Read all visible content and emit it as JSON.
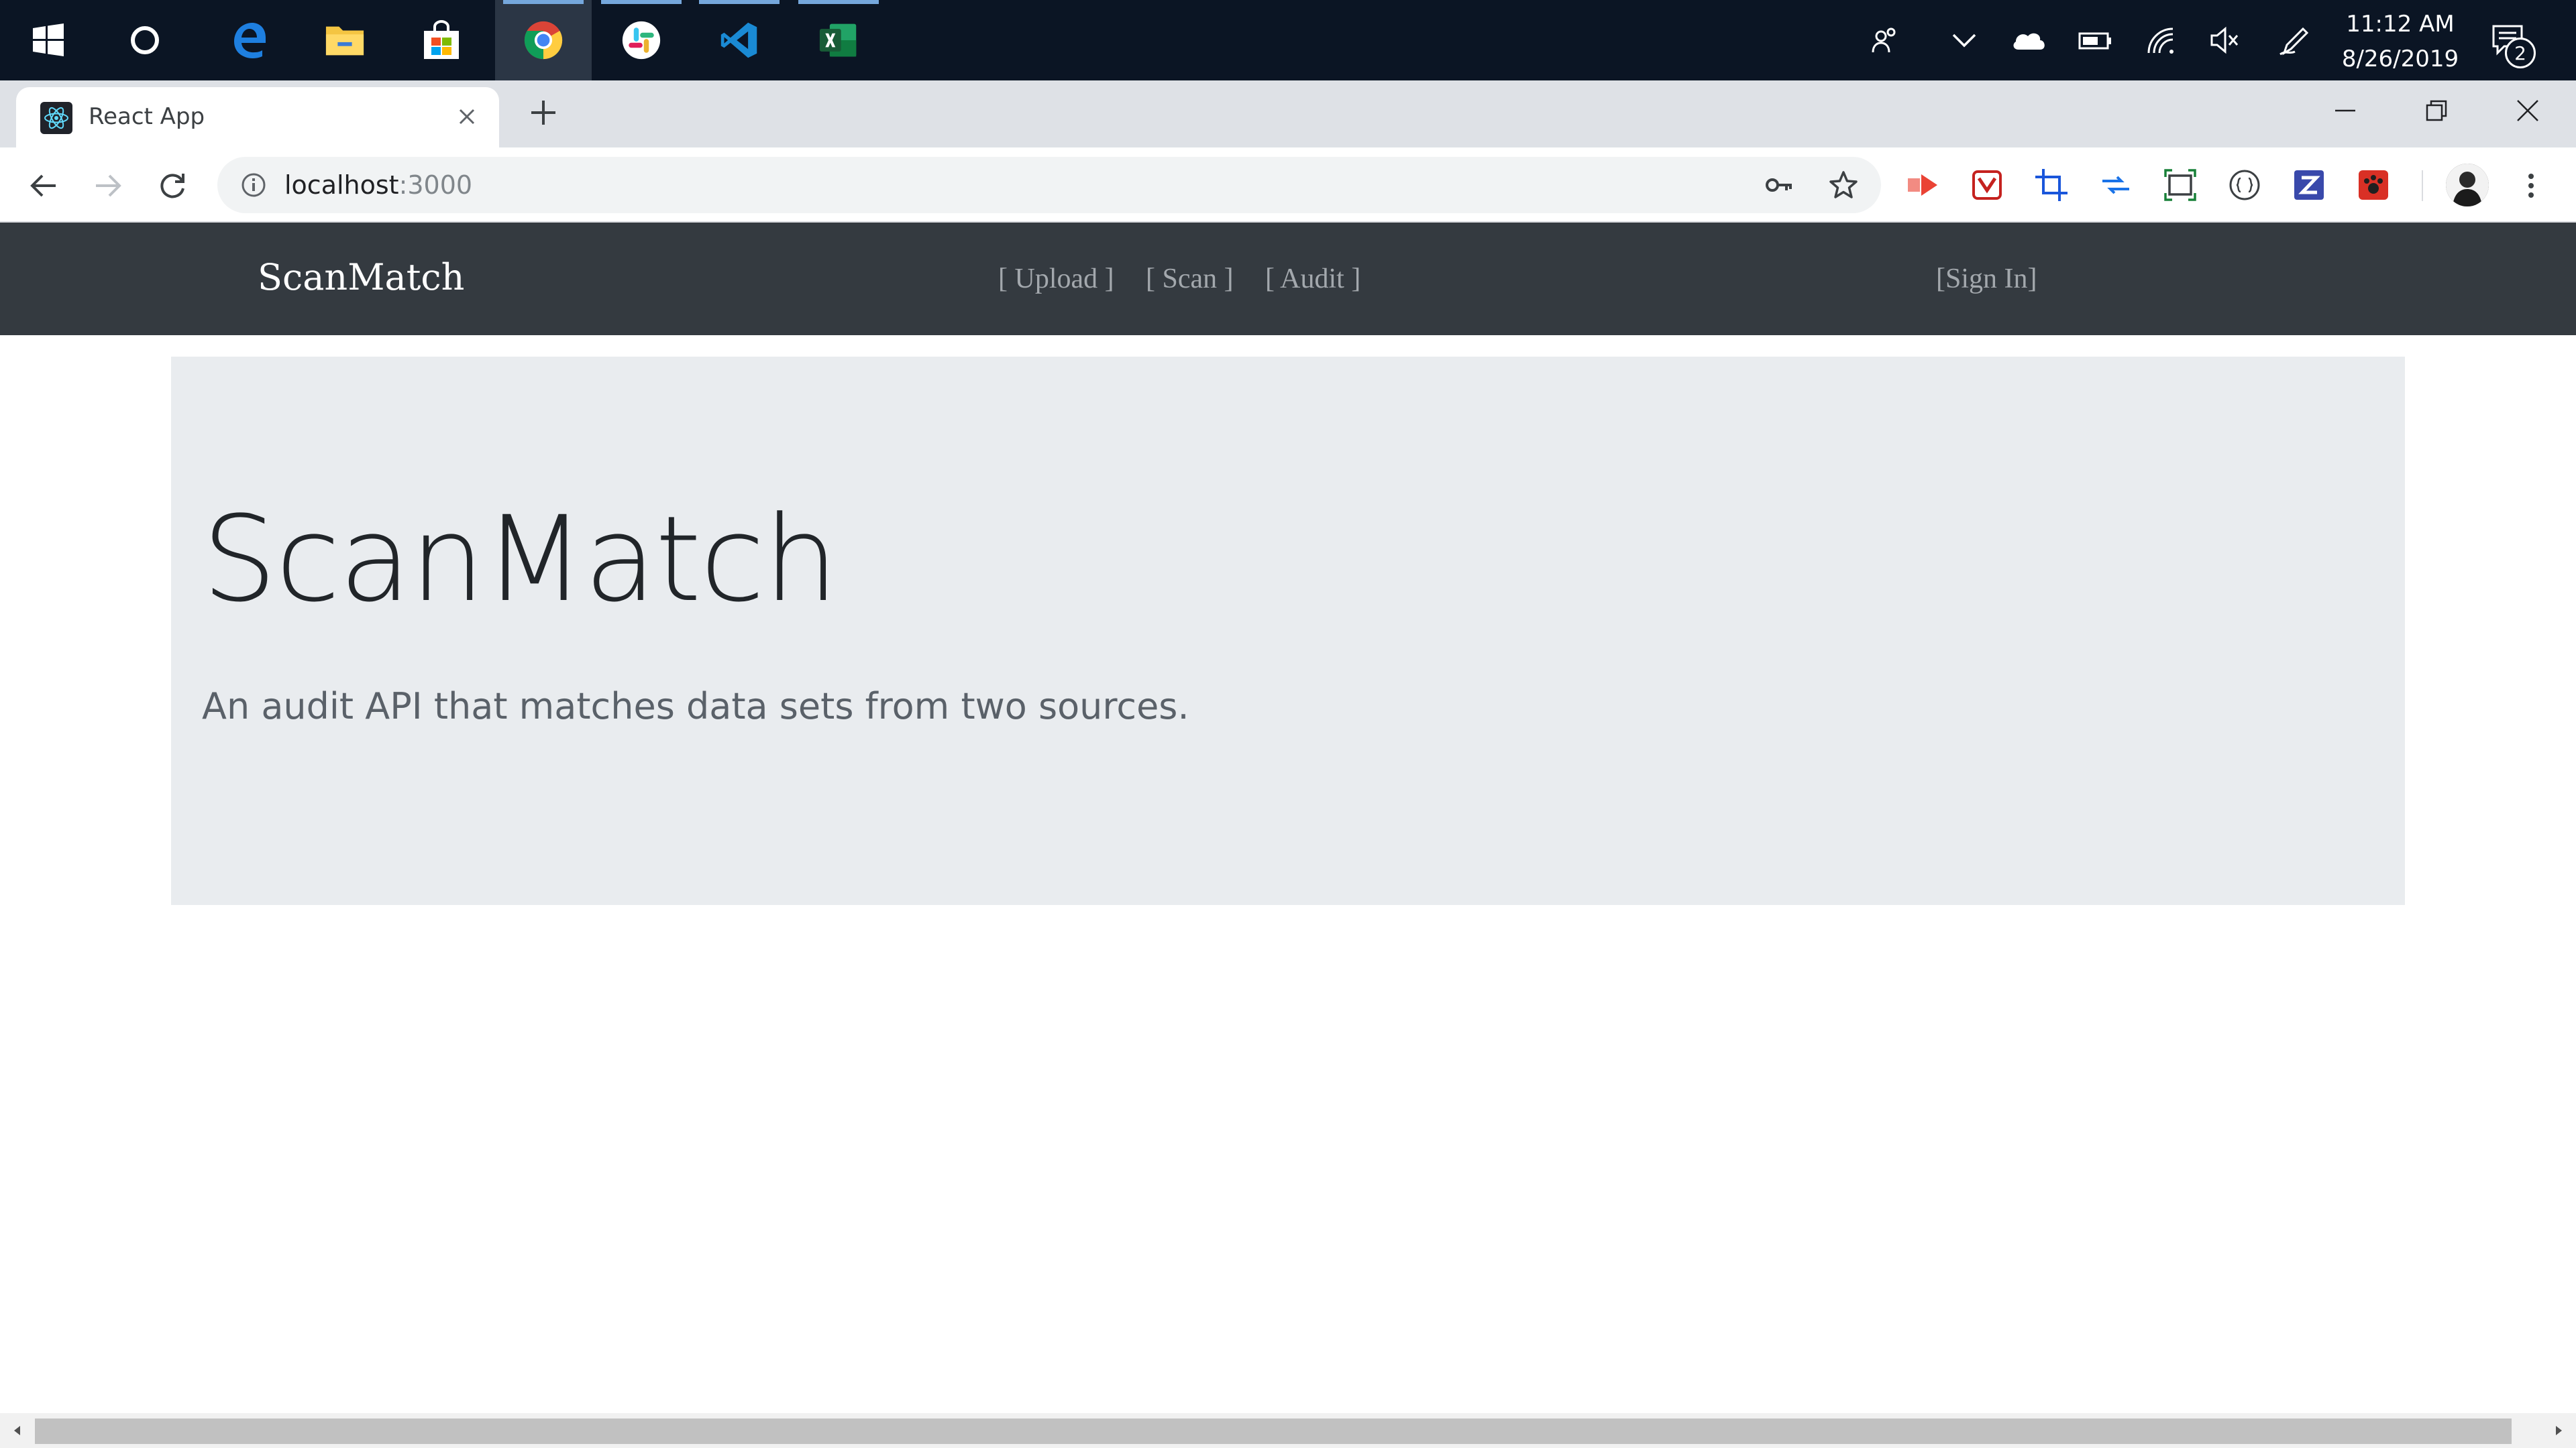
{
  "taskbar": {
    "apps": [
      {
        "name": "start",
        "icon": "windows-logo-icon"
      },
      {
        "name": "cortana",
        "icon": "cortana-circle-icon"
      },
      {
        "name": "edge",
        "icon": "edge-icon"
      },
      {
        "name": "file-explorer",
        "icon": "folder-icon"
      },
      {
        "name": "store",
        "icon": "store-bag-icon"
      },
      {
        "name": "chrome",
        "icon": "chrome-icon",
        "active": true
      },
      {
        "name": "slack",
        "icon": "slack-icon",
        "running": true
      },
      {
        "name": "vscode",
        "icon": "vscode-icon",
        "running": true
      },
      {
        "name": "excel",
        "icon": "excel-icon",
        "running": true
      }
    ],
    "clock": {
      "time": "11:12 AM",
      "date": "8/26/2019"
    },
    "notification_count": "2",
    "colors": {
      "background": "#0b1524",
      "active": "#2b3645",
      "running_indicator": "#75a7dc"
    }
  },
  "browser": {
    "tab": {
      "title": "React App",
      "icon": "react-logo-icon"
    },
    "address": {
      "host": "localhost",
      "port": ":3000"
    }
  },
  "page": {
    "navbar": {
      "brand": "ScanMatch",
      "links": [
        "[ Upload ]",
        "[ Scan ]",
        "[ Audit ]"
      ],
      "signin": "[Sign In]"
    },
    "jumbotron": {
      "title": "ScanMatch",
      "lead": "An audit API that matches data sets from two sources."
    },
    "colors": {
      "navbar": "#343a40",
      "jumbotron": "#e9ecef",
      "nav_link": "#a3a8ad"
    }
  }
}
